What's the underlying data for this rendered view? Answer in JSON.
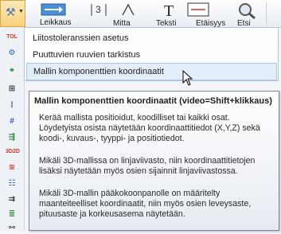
{
  "ribbon": {
    "labels": [
      "Leikkaus",
      "Mitta",
      "Teksti",
      "Etäisyys",
      "Etsi"
    ]
  },
  "left_icons": [
    "tol-icon",
    "check-screw-icon",
    "coordinate-icon",
    "grid-icon",
    "dots-icon",
    "hash-icon",
    "arrow-stack-icon",
    "3d-2d-icon",
    "wave-icon",
    "ladder-icon",
    "line-arrow-icon",
    "stack-icon",
    "chain-icon",
    "bars-icon"
  ],
  "menu": {
    "items": [
      {
        "label": "Liitostoleranssien asetus"
      },
      {
        "label": "Puuttuvien ruuvien tarkistus"
      },
      {
        "label": "Mallin komponenttien koordinaatit"
      }
    ]
  },
  "tooltip": {
    "title": "Mallin komponenttien koordinaatit (video=Shift+klikkaus)",
    "paragraphs": [
      "Kerää mallista positioidut, koodilliset tai kaikki osat. Löydetyista osista näytetään koordinaattitiedot (X,Y,Z) sekä koodi-, kuvaus-, tyyppi- ja positiotiedot.",
      "Mikäli 3D-mallissa on linjaviivasto, niin koordinaattitietojen lisäksi näytetään myös osien sijainnit linjaviivastossa.",
      "Mikäli 3D-mallin pääkokoonpanolle on määritelty maanteiteelliset koordinaatit, niin myös osien leveysaste, pituusaste ja korkeusasema näytetään."
    ]
  }
}
